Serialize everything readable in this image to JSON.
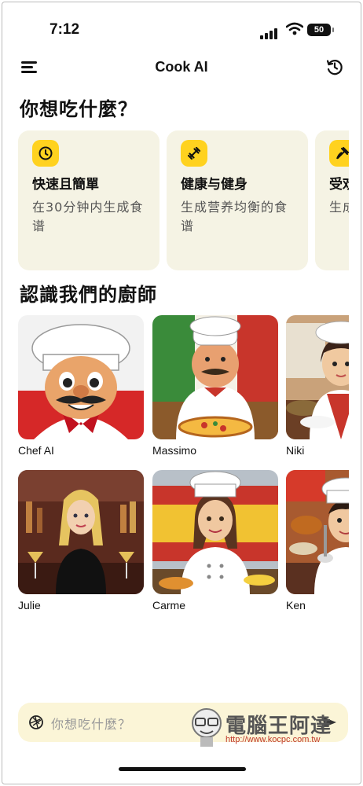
{
  "status_bar": {
    "time": "7:12",
    "battery": "50"
  },
  "header": {
    "title": "Cook AI"
  },
  "section_prompt": {
    "heading": "你想吃什麼？"
  },
  "cards": [
    {
      "title": "快速且簡單",
      "subtitle": "在30分钟内生成食谱",
      "icon": "clock-icon"
    },
    {
      "title": "健康与健身",
      "subtitle": "生成营养均衡的食谱",
      "icon": "dumbbell-icon"
    },
    {
      "title": "受欢",
      "subtitle": "生成的食",
      "icon": "food-icon"
    }
  ],
  "section_chefs": {
    "heading": "認識我們的廚師"
  },
  "chefs": [
    {
      "name": "Chef AI"
    },
    {
      "name": "Massimo"
    },
    {
      "name": "Niki"
    },
    {
      "name": "Julie"
    },
    {
      "name": "Carme"
    },
    {
      "name": "Ken"
    }
  ],
  "input": {
    "placeholder": "你想吃什麼？"
  },
  "watermark": {
    "text": "電腦王阿達",
    "url": "http://www.kocpc.com.tw"
  },
  "colors": {
    "accent": "#ffd21f",
    "card_bg": "#f5f3e4",
    "input_bg": "#fbf5d7"
  }
}
